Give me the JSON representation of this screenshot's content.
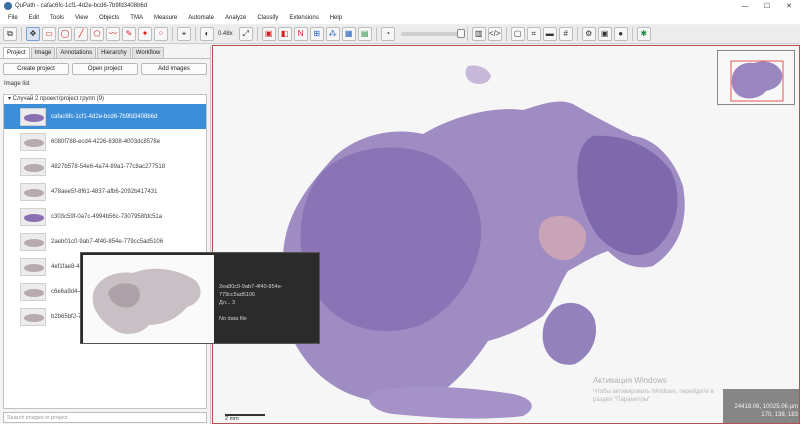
{
  "window": {
    "title": "QuPath - cafac6fc-1cf1-4d2e-bcd6-7b9fd3408b6d",
    "minimize": "—",
    "maximize": "☐",
    "close": "✕"
  },
  "menu": [
    "File",
    "Edit",
    "Tools",
    "View",
    "Objects",
    "TMA",
    "Measure",
    "Automate",
    "Analyze",
    "Classify",
    "Extensions",
    "Help"
  ],
  "toolbar": {
    "zoom_readout": "0.48x"
  },
  "left_panel": {
    "tabs": [
      "Project",
      "Image",
      "Annotations",
      "Hierarchy",
      "Workflow"
    ],
    "buttons": {
      "create_project": "Create project",
      "open_project": "Open project",
      "add_images": "Add images"
    },
    "image_list_label": "Image list",
    "group_label": "▾ Случай 2 проект/project групп (9)",
    "images": [
      {
        "name": "cafac6fc-1cf1-4d2e-bcd6-7b9fd3408b6d",
        "selected": true
      },
      {
        "name": "6080f788-ecd4-4226-8308-4003dc8578e"
      },
      {
        "name": "4827b578-54e6-4a74-89a1-77c8ac277518"
      },
      {
        "name": "478aee5f-8f61-4837-afb6-2092b417431"
      },
      {
        "name": "c303c59f-0a7c-4994b56c-7307958fdc51a"
      },
      {
        "name": "2aeb01c0-9ab7-4f40-854e-779cc5ad5106"
      },
      {
        "name": "4ef1fae8-4"
      },
      {
        "name": "c6e6a9d4-4"
      },
      {
        "name": "b2b65bf2-7"
      }
    ],
    "search_placeholder": "Search images in project"
  },
  "tooltip": {
    "line1": "2ea80c0-9ab7-4f40-854e-779cc5ad5106",
    "line2": "Дл... 3",
    "line3": "No data file"
  },
  "viewer": {
    "scale_bar": "2 mm",
    "watermark_title": "Активация Windows",
    "watermark_sub": "Чтобы активировать Windows, перейдите в раздел \"Параметры\".",
    "coords_line1": "24418.06, 10025.06 µm",
    "coords_line2": "170, 138, 183"
  }
}
